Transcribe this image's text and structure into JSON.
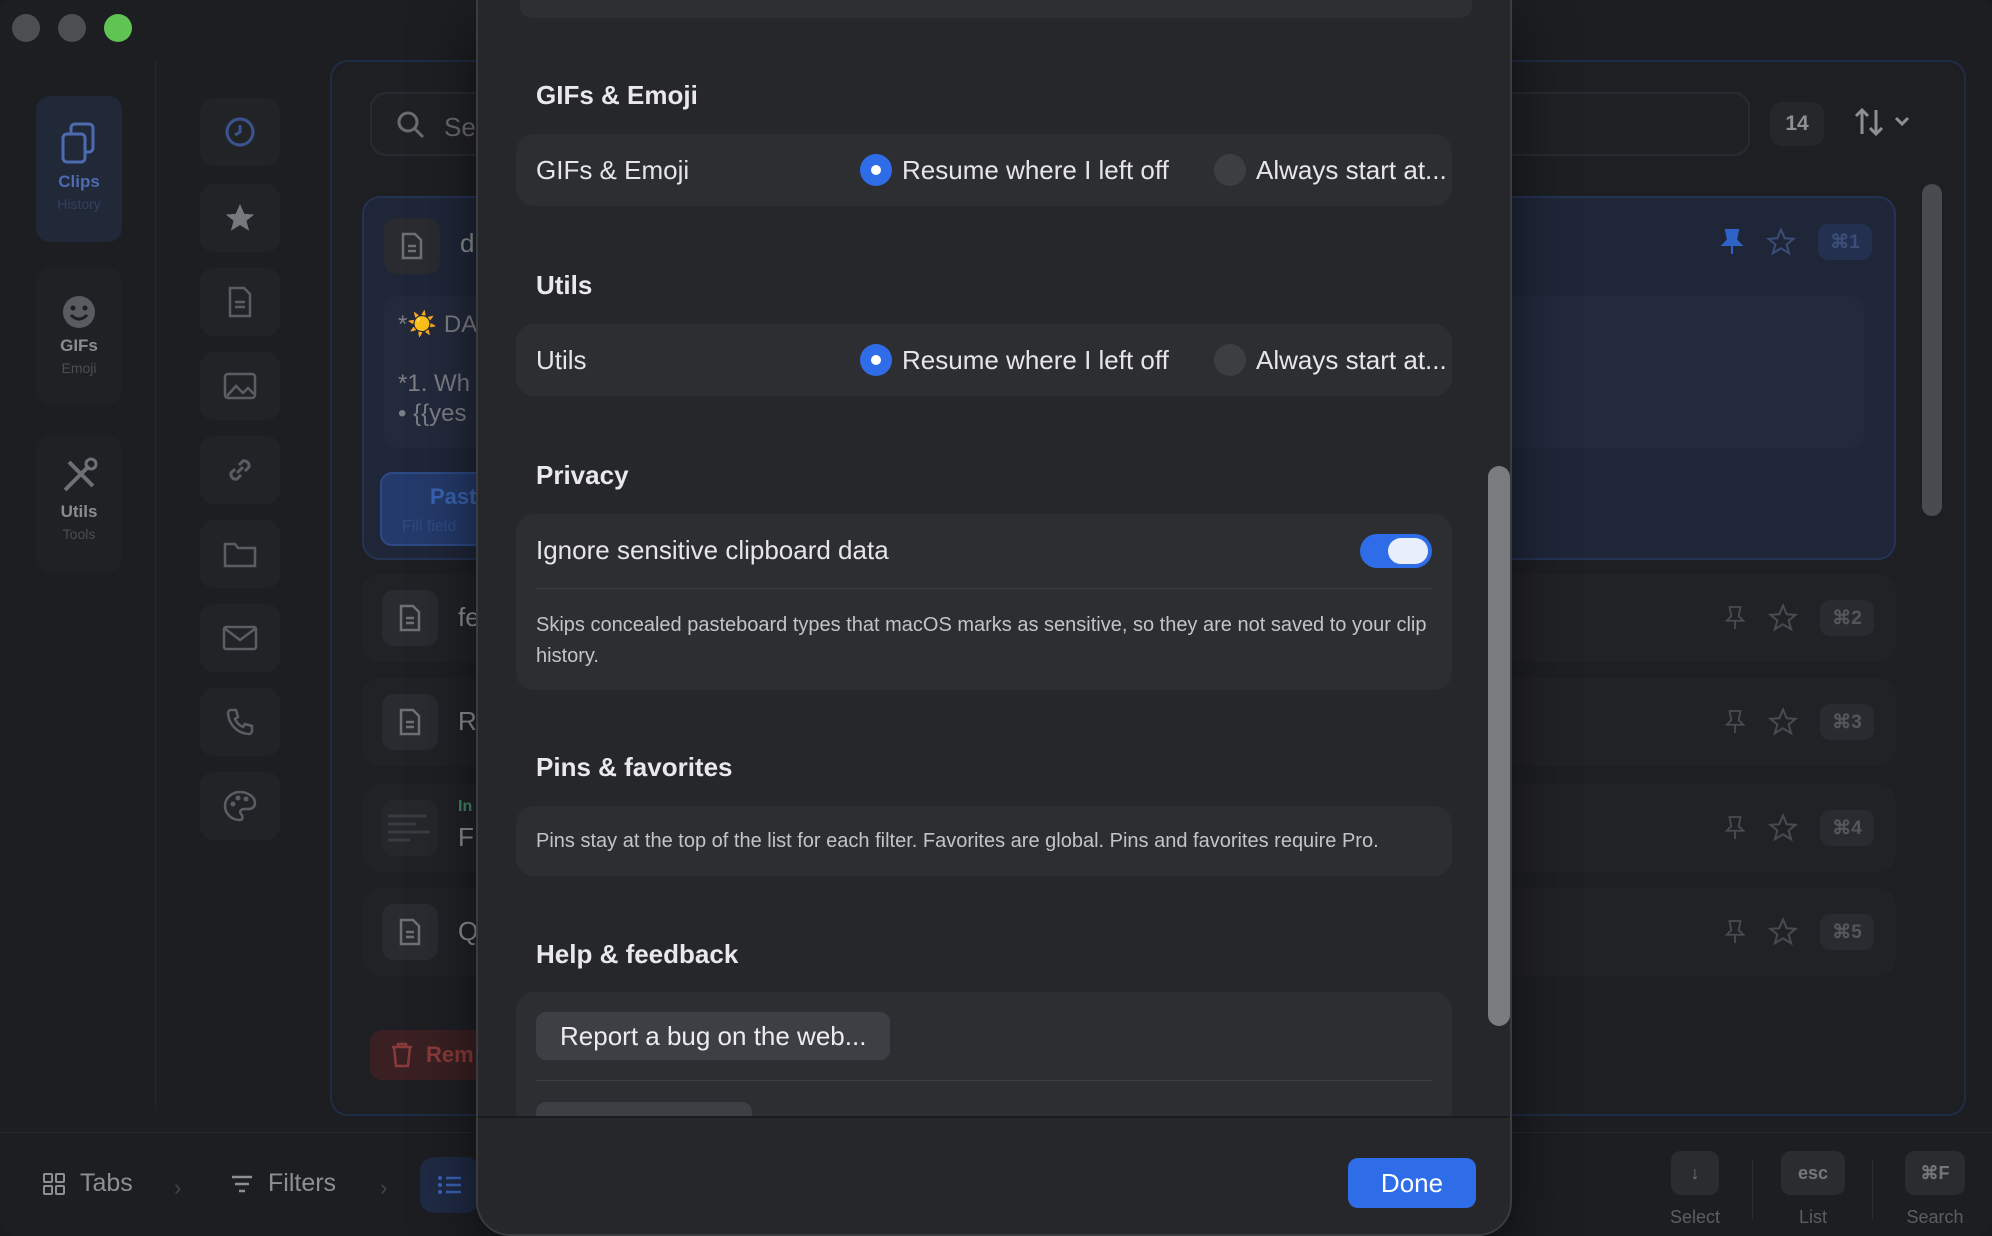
{
  "app": {
    "rail": [
      {
        "label": "Clips",
        "sub": "History"
      },
      {
        "label": "GIFs",
        "sub": "Emoji"
      },
      {
        "label": "Utils",
        "sub": "Tools"
      }
    ],
    "search": {
      "placeholder": "Se"
    },
    "count": "14",
    "clips": [
      {
        "title": "d",
        "shortcut": "⌘1",
        "preview_line1": "*☀️ DA",
        "preview_line2": "*1. Wh",
        "preview_line3": "• {{yes",
        "paste_label": "Past",
        "paste_sub": "Fill field"
      },
      {
        "title": "fe",
        "shortcut": "⌘2"
      },
      {
        "title": "R",
        "shortcut": "⌘3"
      },
      {
        "title": "F",
        "tag": "In",
        "shortcut": "⌘4"
      },
      {
        "title": "Q",
        "shortcut": "⌘5"
      }
    ],
    "remove_label": "Rem",
    "bottom": {
      "tabs": "Tabs",
      "filters": "Filters",
      "hints": [
        {
          "key": "↓",
          "label": "Select"
        },
        {
          "key": "esc",
          "label": "List"
        },
        {
          "key": "⌘F",
          "label": "Search"
        }
      ]
    }
  },
  "settings": {
    "gifs": {
      "section_title": "GIFs & Emoji",
      "row_label": "GIFs & Emoji",
      "option_resume": "Resume where I left off",
      "option_start": "Always start at..."
    },
    "utils": {
      "section_title": "Utils",
      "row_label": "Utils",
      "option_resume": "Resume where I left off",
      "option_start": "Always start at..."
    },
    "privacy": {
      "section_title": "Privacy",
      "toggle_label": "Ignore sensitive clipboard data",
      "toggle_on": true,
      "note": "Skips concealed pasteboard types that macOS marks as sensitive, so they are not saved to your clip history."
    },
    "pins": {
      "section_title": "Pins & favorites",
      "note": "Pins stay at the top of the list for each filter. Favorites are global. Pins and favorites require Pro."
    },
    "help": {
      "section_title": "Help & feedback",
      "bug_button": "Report a bug on the web..."
    },
    "done_label": "Done"
  },
  "colors": {
    "accent": "#2f6de8",
    "sheet_bg": "#25272b",
    "group_bg": "#2c2e32",
    "green_light": "#5fc454"
  }
}
